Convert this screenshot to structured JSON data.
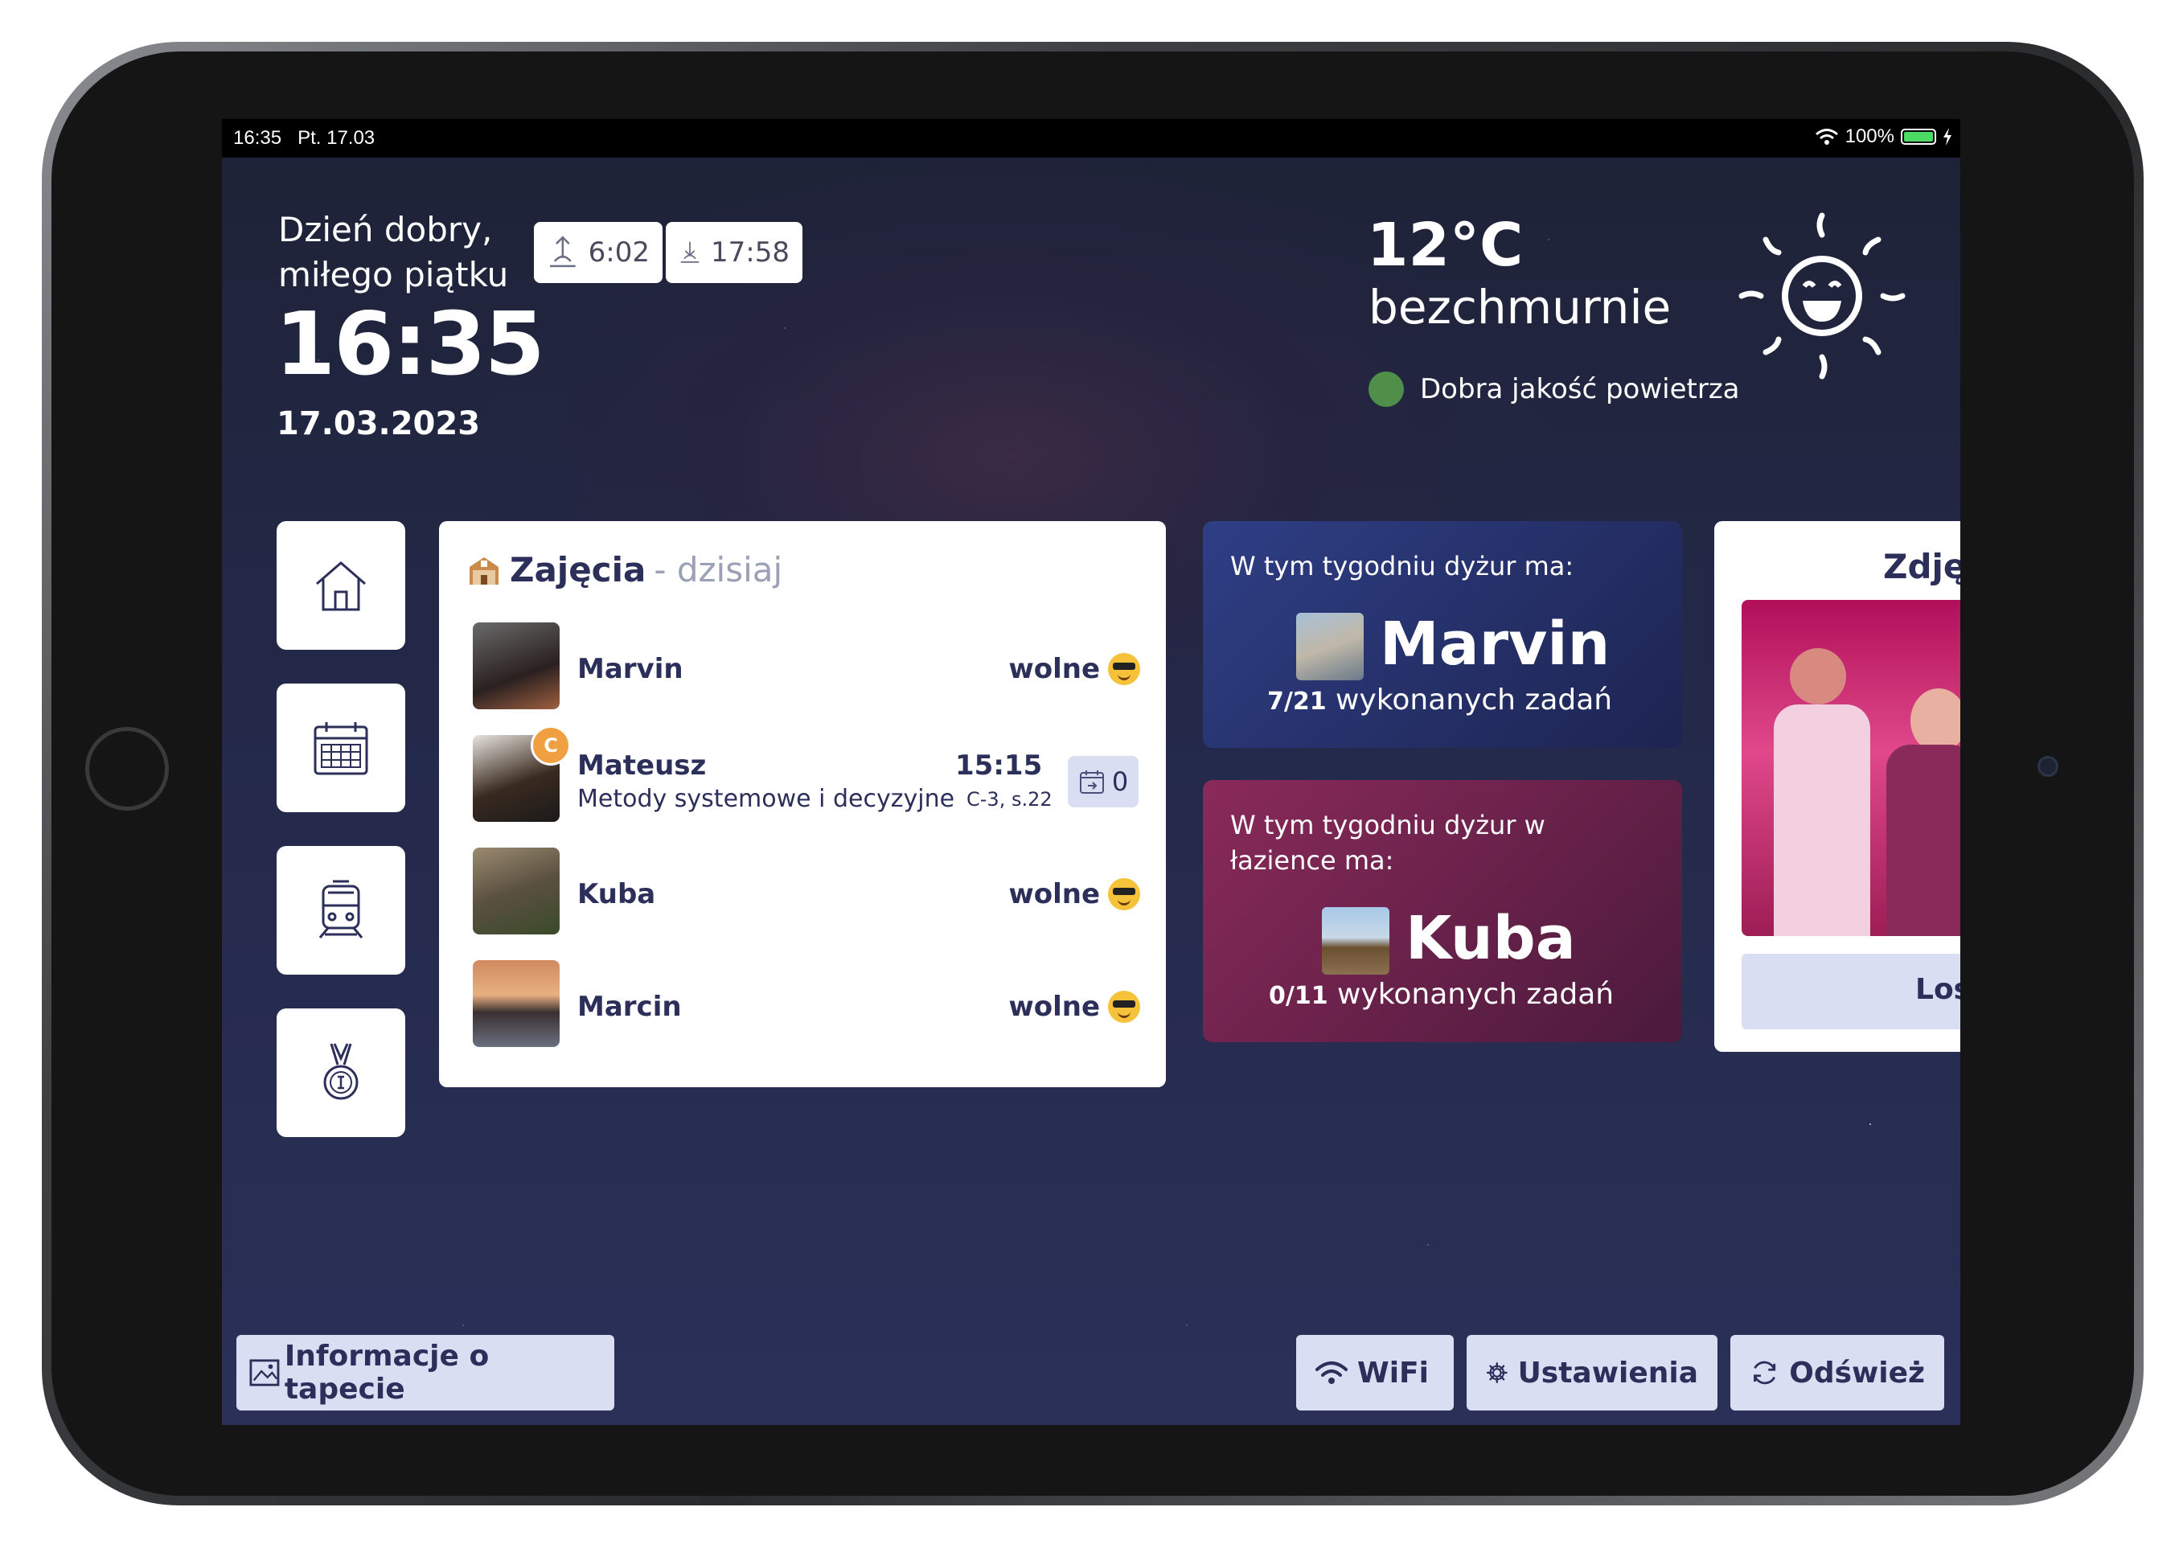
{
  "status_bar": {
    "time": "16:35",
    "day": "Pt. 17.03",
    "battery": "100%",
    "battery_level": 1.0
  },
  "header": {
    "greeting_line1": "Dzień dobry,",
    "greeting_line2": "miłego piątku",
    "time": "16:35",
    "date": "17.03.2023",
    "sunrise": "6:02",
    "sunset": "17:58"
  },
  "weather": {
    "temperature": "12°C",
    "condition": "bezchmurnie",
    "air_quality": "Dobra jakość powietrza",
    "air_quality_color": "#4f8f4a",
    "icon": "sun-icon"
  },
  "nav": [
    {
      "icon": "home-icon"
    },
    {
      "icon": "calendar-icon"
    },
    {
      "icon": "train-icon"
    },
    {
      "icon": "medal-icon"
    }
  ],
  "classes": {
    "title": "Zajęcia",
    "subtitle": "- dzisiaj",
    "rows": [
      {
        "name": "Marvin",
        "status": "wolne"
      },
      {
        "name": "Mateusz",
        "badge": "C",
        "course": "Metody systemowe i decyzyjne",
        "time": "15:15",
        "room": "C-3, s.22",
        "count": "0"
      },
      {
        "name": "Kuba",
        "status": "wolne"
      },
      {
        "name": "Marcin",
        "status": "wolne"
      }
    ]
  },
  "duty_weekly": {
    "label": "W tym tygodniu dyżur ma:",
    "name": "Marvin",
    "done": "7/21",
    "suffix": "wykonanych zadań"
  },
  "duty_bathroom": {
    "label_line1": "W tym tygodniu dyżur w",
    "label_line2": "łazience ma:",
    "name": "Kuba",
    "done": "0/11",
    "suffix": "wykonanych zadań"
  },
  "photo": {
    "title": "Zdję",
    "button": "Los"
  },
  "bottom": {
    "wallpaper_info": "Informacje o tapecie",
    "wifi": "WiFi",
    "settings": "Ustawienia",
    "refresh": "Odśwież"
  },
  "colors": {
    "accent": "#2b2f5a",
    "button_bg": "#d9def3",
    "duty_blue": "#2f3f86",
    "duty_maroon": "#8a2a5a"
  }
}
